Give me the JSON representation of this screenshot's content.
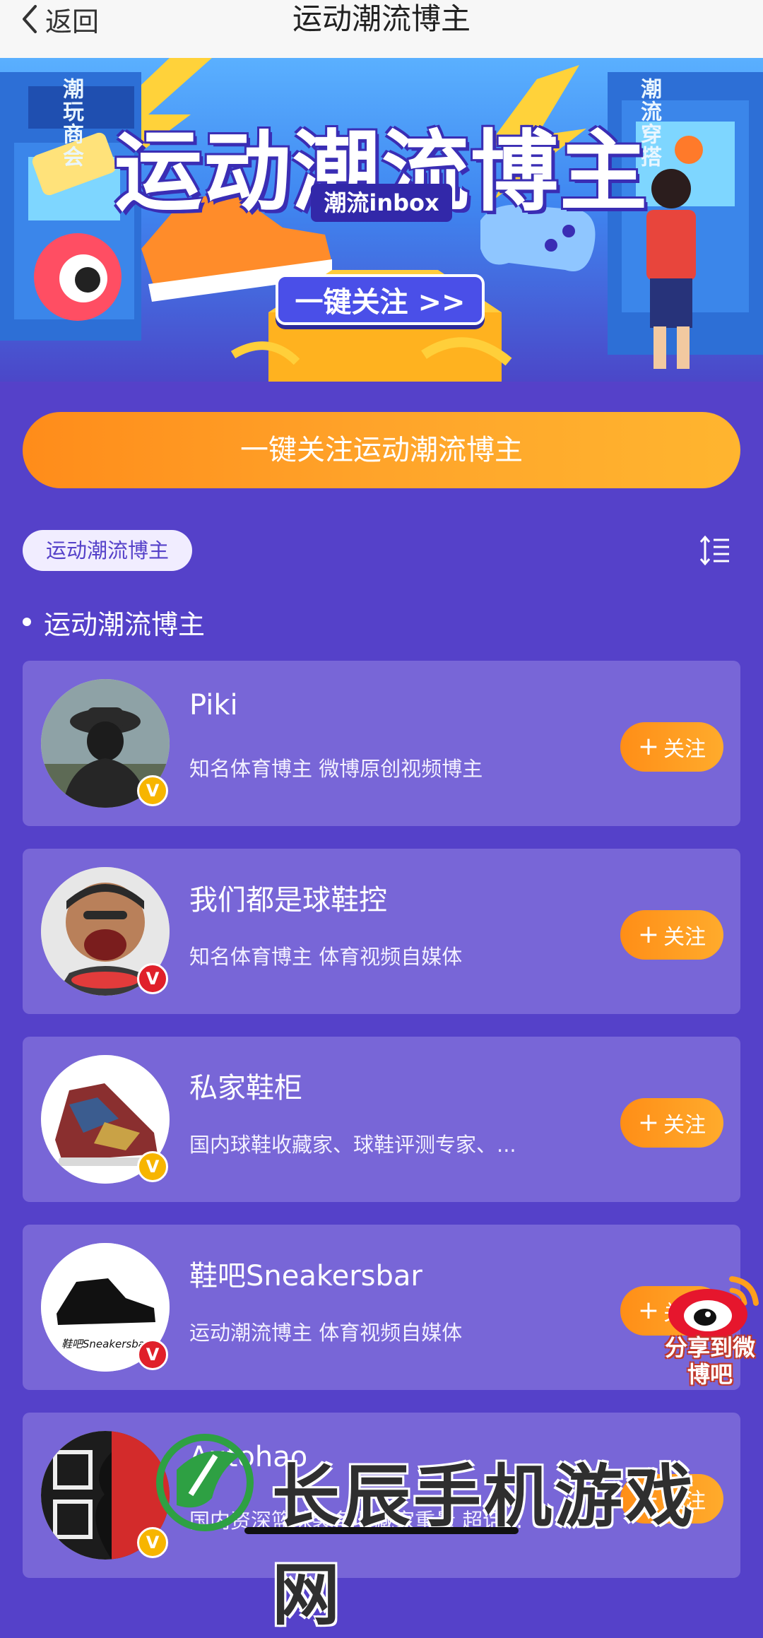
{
  "nav": {
    "back_label": "返回",
    "title": "运动潮流博主"
  },
  "banner": {
    "title": "运动潮流博主",
    "subtitle": "潮流inbox",
    "button_label": "一键关注 >>",
    "deco_left": "潮玩商会",
    "deco_right": "潮流穿搭"
  },
  "main": {
    "follow_all_label": "一键关注运动潮流博主",
    "chip_label": "运动潮流博主",
    "section_title": "运动潮流博主",
    "follow_label": "关注",
    "users": [
      {
        "name": "Piki",
        "desc": "知名体育博主 微博原创视频博主",
        "badge": "V",
        "badge_color": "#f7b500"
      },
      {
        "name": "我们都是球鞋控",
        "desc": "知名体育博主 体育视频自媒体",
        "badge": "V",
        "badge_color": "#e0202a"
      },
      {
        "name": "私家鞋柜",
        "desc": "国内球鞋收藏家、球鞋评测专家、...",
        "badge": "V",
        "badge_color": "#f7b500"
      },
      {
        "name": "鞋吧Sneakersbar",
        "desc": "运动潮流博主 体育视频自媒体",
        "badge": "V",
        "badge_color": "#e0202a",
        "avatar_text": "鞋吧Sneakersbar"
      },
      {
        "name": "Autohao",
        "desc": "国内资深篮球装备收藏家重量 超话...",
        "badge": "V",
        "badge_color": "#f7b500"
      }
    ]
  },
  "share_float": {
    "label": "分享到微博吧"
  },
  "watermark": {
    "text": "长辰手机游戏网"
  },
  "colors": {
    "page_bg": "#5541c9",
    "card_bg": "#7866d7",
    "accent_orange": "#ff9a1f"
  }
}
